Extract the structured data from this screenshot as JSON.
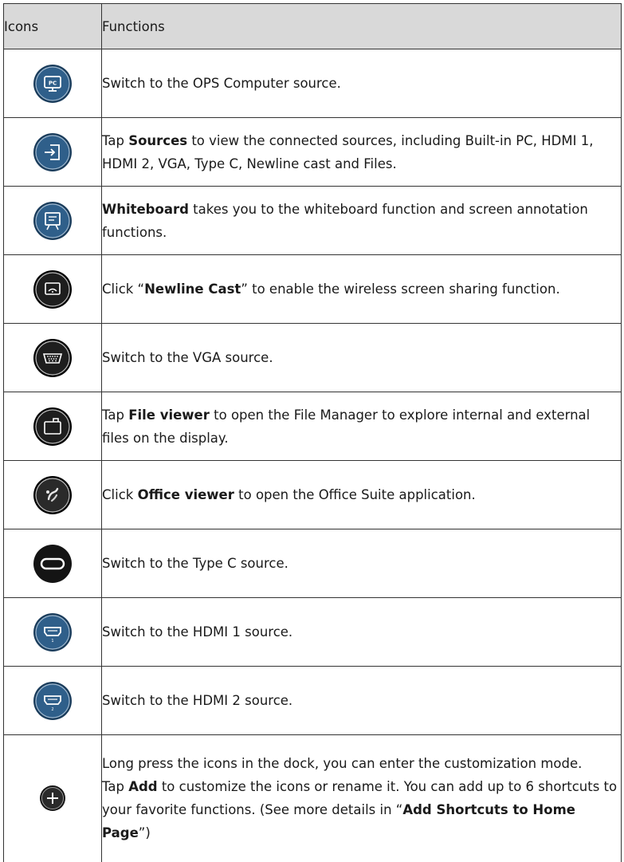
{
  "header": {
    "col_icons": "Icons",
    "col_functions": "Functions"
  },
  "rows": [
    {
      "icon": "pc-monitor-icon",
      "text": [
        {
          "t": "Switch to the OPS Computer source."
        }
      ]
    },
    {
      "icon": "sources-input-icon",
      "text": [
        {
          "t": "Tap "
        },
        {
          "b": "Sources"
        },
        {
          "t": " to view the connected sources, including Built-in PC, HDMI 1, HDMI 2, VGA, Type C, Newline cast and Files."
        }
      ]
    },
    {
      "icon": "whiteboard-icon",
      "text": [
        {
          "b": "Whiteboard"
        },
        {
          "t": " takes you to the whiteboard function and screen annotation functions."
        }
      ]
    },
    {
      "icon": "newline-cast-icon",
      "text": [
        {
          "t": "Click “"
        },
        {
          "b": "Newline Cast"
        },
        {
          "t": "” to enable the wireless screen sharing function."
        }
      ]
    },
    {
      "icon": "vga-port-icon",
      "text": [
        {
          "t": "Switch to the VGA source."
        }
      ]
    },
    {
      "icon": "file-viewer-icon",
      "text": [
        {
          "t": "Tap "
        },
        {
          "b": "File viewer"
        },
        {
          "t": " to open the File Manager to explore internal and external files on the display."
        }
      ]
    },
    {
      "icon": "office-viewer-icon",
      "text": [
        {
          "t": "Click "
        },
        {
          "b": "Office viewer"
        },
        {
          "t": " to open the Office Suite application."
        }
      ]
    },
    {
      "icon": "type-c-icon",
      "text": [
        {
          "t": "Switch to the Type C source."
        }
      ]
    },
    {
      "icon": "hdmi-1-icon",
      "text": [
        {
          "t": "Switch to the HDMI 1 source."
        }
      ]
    },
    {
      "icon": "hdmi-2-icon",
      "text": [
        {
          "t": "Switch to the HDMI 2 source."
        }
      ]
    },
    {
      "icon": "add-plus-icon",
      "text": [
        {
          "t": "Long press the icons in the dock, you can enter the customization mode."
        },
        {
          "br": true
        },
        {
          "t": "Tap "
        },
        {
          "b": "Add"
        },
        {
          "t": " to customize the icons or rename it. You can add up to 6 shortcuts to your favorite functions. (See more details in “"
        },
        {
          "b": "Add Shortcuts to Home Page"
        },
        {
          "t": "”)"
        }
      ]
    }
  ],
  "icon_labels": {
    "pc": "PC",
    "hdmi1": "1",
    "hdmi2": "2"
  },
  "colors": {
    "blue_icon": "#2f5f8a",
    "dark_icon": "#141414",
    "header_bg": "#d9d9d9"
  }
}
